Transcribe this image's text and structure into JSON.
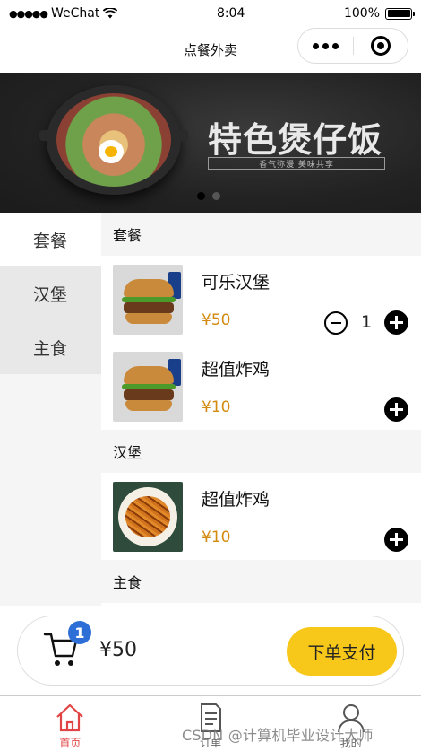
{
  "status_bar": {
    "carrier": "WeChat",
    "time": "8:04",
    "battery": "100%"
  },
  "nav": {
    "title": "点餐外卖"
  },
  "banner": {
    "headline": "特色煲仔饭",
    "subline": "香气弥漫  美味共享",
    "page_count": 2,
    "active_page": 1
  },
  "sidebar": {
    "categories": [
      "套餐",
      "汉堡",
      "主食"
    ],
    "active_index": 0
  },
  "menu": {
    "sections": [
      {
        "title": "套餐",
        "items": [
          {
            "name": "可乐汉堡",
            "price": "¥50",
            "qty": "1",
            "image": "burger-photo"
          },
          {
            "name": "超值炸鸡",
            "price": "¥10",
            "qty": "",
            "image": "burger-photo"
          }
        ]
      },
      {
        "title": "汉堡",
        "items": [
          {
            "name": "超值炸鸡",
            "price": "¥10",
            "qty": "",
            "image": "fries-photo"
          }
        ]
      },
      {
        "title": "主食",
        "items": []
      }
    ]
  },
  "cart": {
    "count": "1",
    "total": "¥50",
    "checkout_label": "下单支付"
  },
  "tabbar": {
    "tabs": [
      {
        "label": "首页",
        "icon": "home-icon",
        "active": true
      },
      {
        "label": "订单",
        "icon": "order-icon",
        "active": false
      },
      {
        "label": "我的",
        "icon": "user-icon",
        "active": false
      }
    ]
  },
  "watermark": "CSDN @计算机毕业设计大师",
  "colors": {
    "accent_price": "#d28a10",
    "checkout": "#f7c71a",
    "badge": "#2d6fd6",
    "tab_active": "#e04444"
  }
}
